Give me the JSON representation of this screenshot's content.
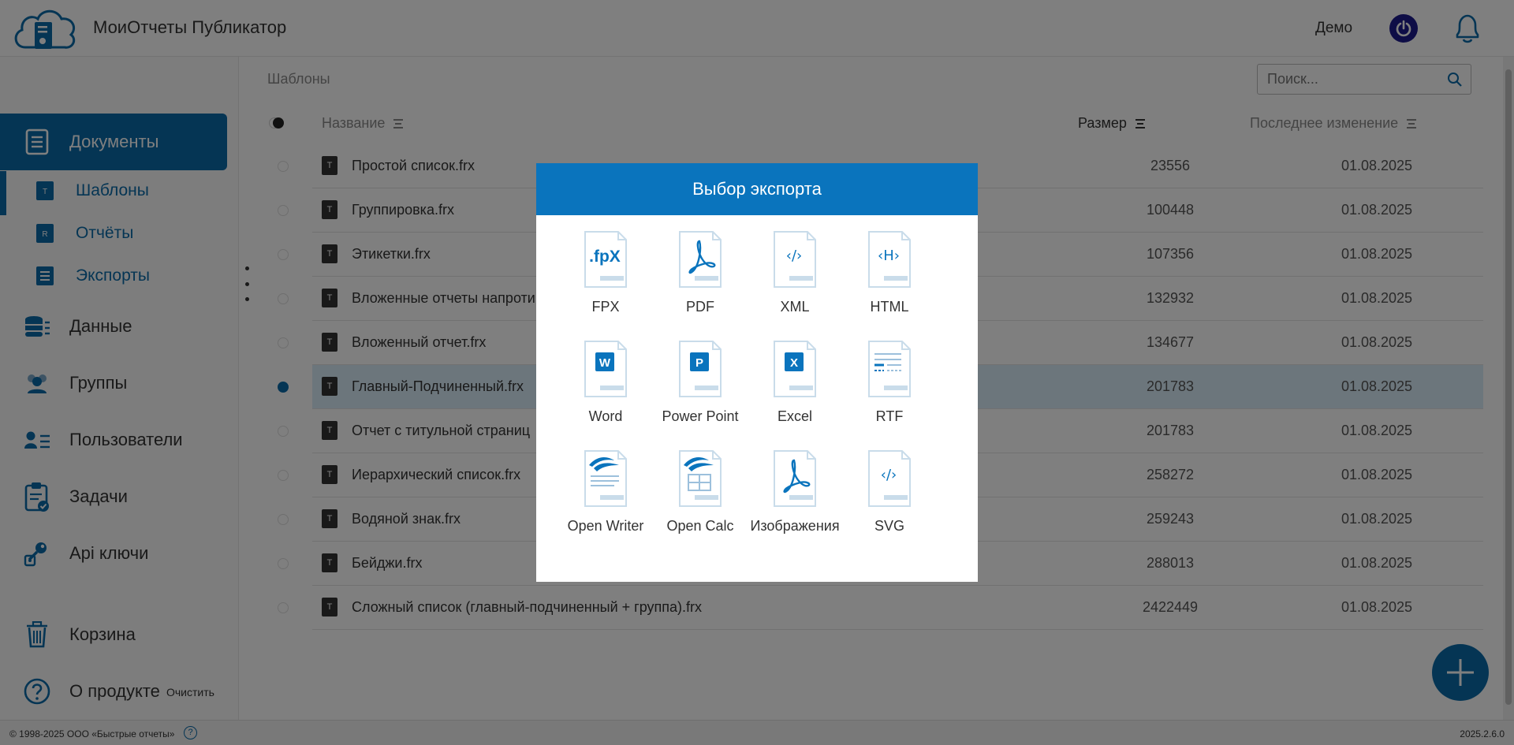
{
  "header": {
    "app_title": "МоиОтчеты Публикатор",
    "user_name": "Демо"
  },
  "sidebar": {
    "documents": "Документы",
    "sub": [
      "Шаблоны",
      "Отчёты",
      "Экспорты"
    ],
    "sub_icon_letters": [
      "T",
      "R",
      ""
    ],
    "items": [
      "Данные",
      "Группы",
      "Пользователи",
      "Задачи",
      "Api ключи"
    ],
    "trash": "Корзина",
    "clear": "Очистить",
    "about": "О продукте"
  },
  "main": {
    "breadcrumb": "Шаблоны",
    "search_placeholder": "Поиск...",
    "columns": {
      "name": "Название",
      "size": "Размер",
      "modified": "Последнее изменение"
    },
    "rows": [
      {
        "name": "Простой список.frx",
        "size": "23556",
        "date": "01.08.2025",
        "icon": "T"
      },
      {
        "name": "Группировка.frx",
        "size": "100448",
        "date": "01.08.2025",
        "icon": "T"
      },
      {
        "name": "Этикетки.frx",
        "size": "107356",
        "date": "01.08.2025",
        "icon": "T"
      },
      {
        "name": "Вложенные отчеты напроти",
        "size": "132932",
        "date": "01.08.2025",
        "icon": "T"
      },
      {
        "name": "Вложенный отчет.frx",
        "size": "134677",
        "date": "01.08.2025",
        "icon": "T"
      },
      {
        "name": "Главный-Подчиненный.frx",
        "size": "201783",
        "date": "01.08.2025",
        "icon": "T",
        "selected": true
      },
      {
        "name": "Отчет с титульной страниц",
        "size": "201783",
        "date": "01.08.2025",
        "icon": "T"
      },
      {
        "name": "Иерархический список.frx",
        "size": "258272",
        "date": "01.08.2025",
        "icon": "T"
      },
      {
        "name": "Водяной знак.frx",
        "size": "259243",
        "date": "01.08.2025",
        "icon": "T"
      },
      {
        "name": "Бейджи.frx",
        "size": "288013",
        "date": "01.08.2025",
        "icon": "T"
      },
      {
        "name": "Сложный список (главный-подчиненный + группа).frx",
        "size": "2422449",
        "date": "01.08.2025",
        "icon": "T"
      }
    ]
  },
  "footer": {
    "copyright": "© 1998-2025 ООО «Быстрые отчеты»",
    "help": "?",
    "version": "2025.2.6.0"
  },
  "modal": {
    "title": "Выбор экспорта",
    "options": [
      {
        "label": "FPX",
        "icon": "fpx-icon",
        "glyph": ".fpX"
      },
      {
        "label": "PDF",
        "icon": "pdf-icon",
        "glyph": ""
      },
      {
        "label": "XML",
        "icon": "xml-icon",
        "glyph": "‹/›"
      },
      {
        "label": "HTML",
        "icon": "html-icon",
        "glyph": "‹H›"
      },
      {
        "label": "Word",
        "icon": "word-icon",
        "glyph": "W"
      },
      {
        "label": "Power Point",
        "icon": "powerpoint-icon",
        "glyph": "P"
      },
      {
        "label": "Excel",
        "icon": "excel-icon",
        "glyph": "X"
      },
      {
        "label": "RTF",
        "icon": "rtf-icon",
        "glyph": ""
      },
      {
        "label": "Open Writer",
        "icon": "open-writer-icon",
        "glyph": ""
      },
      {
        "label": "Open Calc",
        "icon": "open-calc-icon",
        "glyph": ""
      },
      {
        "label": "Изображения",
        "icon": "image-icon",
        "glyph": ""
      },
      {
        "label": "SVG",
        "icon": "svg-icon",
        "glyph": "‹/›"
      }
    ]
  },
  "colors": {
    "accent": "#0a6aa8",
    "modal_header": "#0a74bd",
    "power": "#1d1a8c"
  }
}
